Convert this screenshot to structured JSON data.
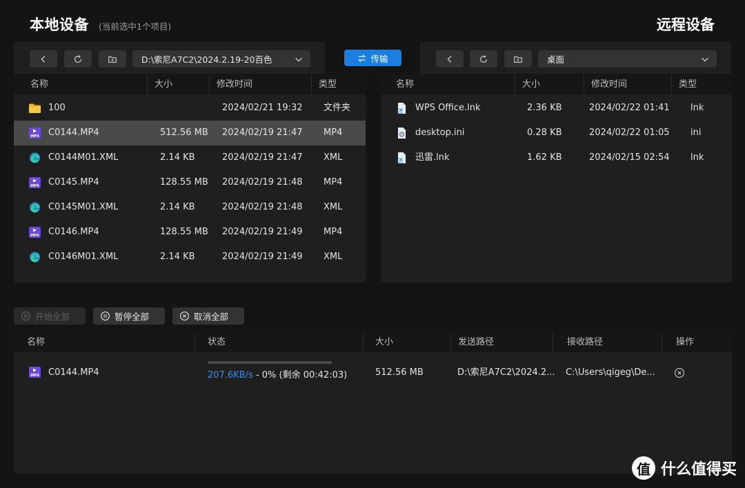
{
  "header": {
    "local_title": "本地设备",
    "local_subtitle": "(当前选中1个项目)",
    "remote_title": "远程设备"
  },
  "local": {
    "path": "D:\\索尼A7C2\\2024.2.19-20百色",
    "columns": [
      "名称",
      "大小",
      "修改时间",
      "类型"
    ],
    "rows": [
      {
        "icon": "folder-icon",
        "name": "100",
        "size": "",
        "modified": "2024/02/21 19:32",
        "type": "文件夹",
        "selected": false
      },
      {
        "icon": "mp4-file-icon",
        "name": "C0144.MP4",
        "size": "512.56 MB",
        "modified": "2024/02/19 21:47",
        "type": "MP4",
        "selected": true
      },
      {
        "icon": "xml-file-icon",
        "name": "C0144M01.XML",
        "size": "2.14 KB",
        "modified": "2024/02/19 21:47",
        "type": "XML",
        "selected": false
      },
      {
        "icon": "mp4-file-icon",
        "name": "C0145.MP4",
        "size": "128.55 MB",
        "modified": "2024/02/19 21:48",
        "type": "MP4",
        "selected": false
      },
      {
        "icon": "xml-file-icon",
        "name": "C0145M01.XML",
        "size": "2.14 KB",
        "modified": "2024/02/19 21:48",
        "type": "XML",
        "selected": false
      },
      {
        "icon": "mp4-file-icon",
        "name": "C0146.MP4",
        "size": "128.55 MB",
        "modified": "2024/02/19 21:49",
        "type": "MP4",
        "selected": false
      },
      {
        "icon": "xml-file-icon",
        "name": "C0146M01.XML",
        "size": "2.14 KB",
        "modified": "2024/02/19 21:49",
        "type": "XML",
        "selected": false
      }
    ]
  },
  "transfer_button": {
    "label": "传输",
    "icon": "swap-arrows-icon"
  },
  "remote": {
    "path": "桌面",
    "columns": [
      "名称",
      "大小",
      "修改时间",
      "类型"
    ],
    "rows": [
      {
        "icon": "shortcut-file-icon",
        "name": "WPS Office.lnk",
        "size": "2.36 KB",
        "modified": "2024/02/22 01:41",
        "type": "lnk"
      },
      {
        "icon": "settings-file-icon",
        "name": "desktop.ini",
        "size": "0.28 KB",
        "modified": "2024/02/22 01:05",
        "type": "ini"
      },
      {
        "icon": "shortcut-file-icon",
        "name": "迅雷.lnk",
        "size": "1.62 KB",
        "modified": "2024/02/15 02:54",
        "type": "lnk"
      }
    ]
  },
  "controls": {
    "start_all": "开始全部",
    "pause_all": "暂停全部",
    "cancel_all": "取消全部"
  },
  "queue": {
    "columns": [
      "名称",
      "状态",
      "大小",
      "发送路径",
      "接收路径",
      "操作"
    ],
    "rows": [
      {
        "icon": "mp4-file-icon",
        "name": "C0144.MP4",
        "speed": "207.6KB/s",
        "status_rest": " - 0% (剩余 00:42:03)",
        "progress_percent": 0,
        "size": "512.56 MB",
        "send_path": "D:\\索尼A7C2\\2024.2...",
        "recv_path": "C:\\Users\\qigeg\\De..."
      }
    ]
  },
  "watermark": {
    "logo_char": "值",
    "text": "什么值得买"
  },
  "colors": {
    "accent": "#1a7fe0",
    "background": "#141414",
    "panel": "#1f1f1f",
    "selected_row": "#4a4a4a"
  }
}
